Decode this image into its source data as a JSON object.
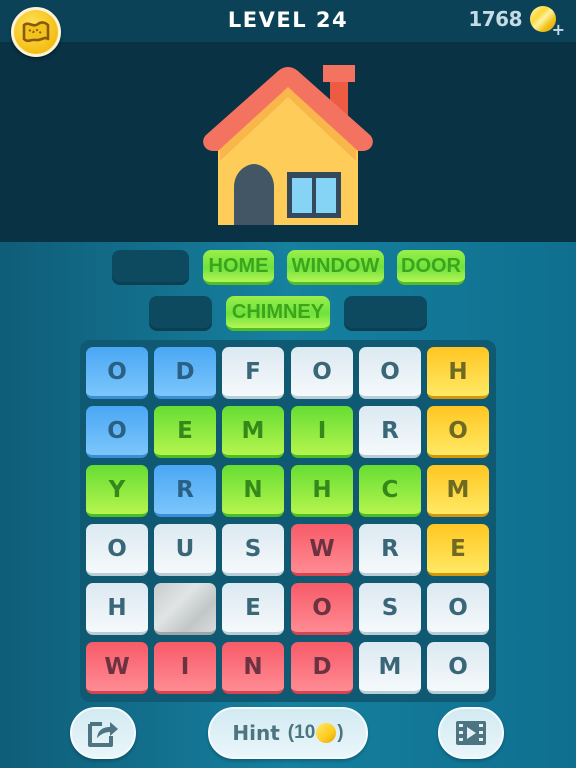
{
  "header": {
    "map_button_icon": "treasure-map-icon",
    "level_label": "LEVEL 24",
    "coin_count": "1768",
    "coin_icon": "coin-icon",
    "add_coins_icon": "plus-icon"
  },
  "picture": {
    "subject": "house",
    "icon": "house-icon"
  },
  "words": {
    "row1": [
      {
        "label": "",
        "found": false
      },
      {
        "label": "HOME",
        "found": true
      },
      {
        "label": "WINDOW",
        "found": true
      },
      {
        "label": "DOOR",
        "found": true
      }
    ],
    "row2": [
      {
        "label": "",
        "found": false
      },
      {
        "label": "CHIMNEY",
        "found": true
      },
      {
        "label": "",
        "found": false
      }
    ]
  },
  "grid": {
    "rows": [
      [
        "O",
        "D",
        "F",
        "O",
        "O",
        "H"
      ],
      [
        "O",
        "E",
        "M",
        "I",
        "R",
        "O"
      ],
      [
        "Y",
        "R",
        "N",
        "H",
        "C",
        "M"
      ],
      [
        "O",
        "U",
        "S",
        "W",
        "R",
        "E"
      ],
      [
        "H",
        "",
        "E",
        "O",
        "S",
        "O"
      ],
      [
        "W",
        "I",
        "N",
        "D",
        "M",
        "O"
      ]
    ],
    "colors": [
      [
        "blue",
        "blue",
        "white",
        "white",
        "white",
        "yellow"
      ],
      [
        "blue",
        "green",
        "green",
        "green",
        "white",
        "yellow"
      ],
      [
        "green",
        "blue",
        "green",
        "green",
        "green",
        "yellow"
      ],
      [
        "white",
        "white",
        "white",
        "red",
        "white",
        "yellow"
      ],
      [
        "white",
        "stone",
        "white",
        "red",
        "white",
        "white"
      ],
      [
        "red",
        "red",
        "red",
        "red",
        "white",
        "white"
      ]
    ],
    "color_hex": {
      "blue": "#5db5f8",
      "green": "#7be63e",
      "yellow": "#ffd63a",
      "red": "#fb6f7b",
      "white": "#eaf3f7",
      "stone": "#cfd3d3"
    }
  },
  "footer": {
    "share_icon": "share-icon",
    "hint_label": "Hint",
    "hint_cost_open": "(10",
    "hint_cost_close": ")",
    "video_icon": "video-icon"
  }
}
